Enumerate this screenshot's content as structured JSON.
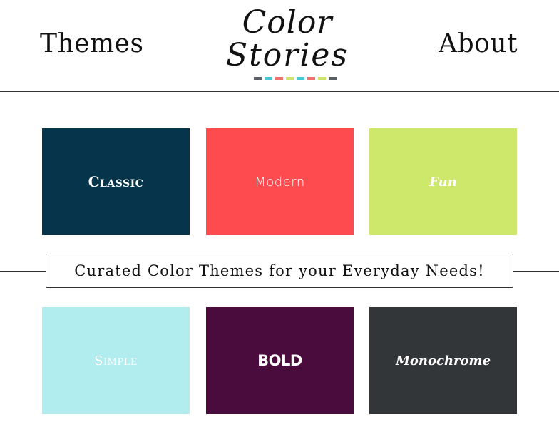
{
  "header": {
    "nav_left": "Themes",
    "nav_right": "About",
    "logo": {
      "line1": "Color",
      "line2": "Stories",
      "dash_colors": [
        "#5b5f66",
        "#46c8d3",
        "#f2706e",
        "#cde36b",
        "#46c8d3",
        "#f2706e",
        "#cde36b",
        "#5b5f66"
      ]
    }
  },
  "themes_row_1": [
    {
      "label": "Classic",
      "color": "#06344a"
    },
    {
      "label": "Modern",
      "color": "#fe4b4f"
    },
    {
      "label": "Fun",
      "color": "#cde86b"
    }
  ],
  "tagline": "Curated Color Themes for your Everyday Needs!",
  "themes_row_2": [
    {
      "label": "Simple",
      "color": "#b1ecee"
    },
    {
      "label": "BOLD",
      "color": "#4a0b3d"
    },
    {
      "label": "Monochrome",
      "color": "#333638"
    }
  ]
}
